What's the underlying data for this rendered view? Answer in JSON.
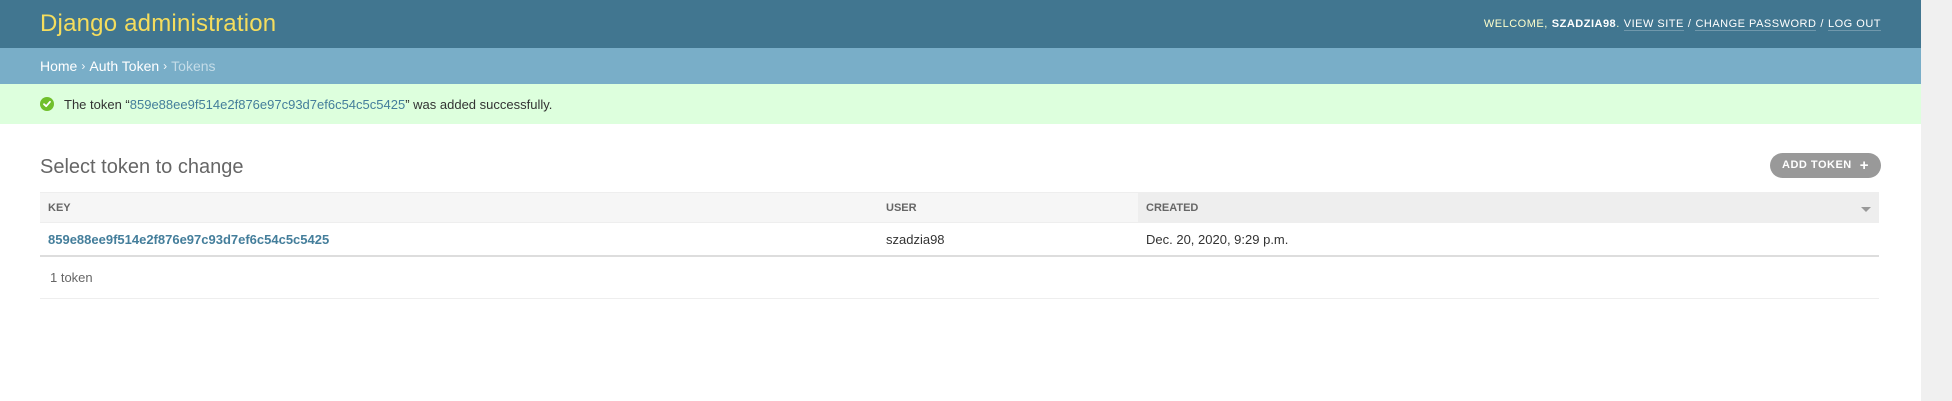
{
  "header": {
    "branding": "Django administration",
    "welcome_label": "Welcome,",
    "username": "szadzia98",
    "view_site": "View site",
    "change_password": "Change password",
    "log_out": "Log out",
    "separator": "/"
  },
  "breadcrumbs": {
    "home": "Home",
    "app": "Auth Token",
    "current": "Tokens",
    "separator": "›"
  },
  "message": {
    "prefix": "The token “",
    "token_link": "859e88ee9f514e2f876e97c93d7ef6c54c5c5425",
    "suffix": "” was added successfully."
  },
  "content": {
    "title": "Select token to change",
    "add_button": "Add token",
    "add_icon": "+"
  },
  "table": {
    "columns": [
      "Key",
      "User",
      "Created"
    ],
    "rows": [
      {
        "key": "859e88ee9f514e2f876e97c93d7ef6c54c5c5425",
        "user": "szadzia98",
        "created": "Dec. 20, 2020, 9:29 p.m."
      }
    ]
  },
  "paginator": {
    "count_text": "1 token"
  },
  "colors": {
    "header_bg": "#417690",
    "breadcrumbs_bg": "#79aec8",
    "success_bg": "#ddffdd",
    "link": "#447e9b",
    "branding": "#f5dd5d"
  }
}
